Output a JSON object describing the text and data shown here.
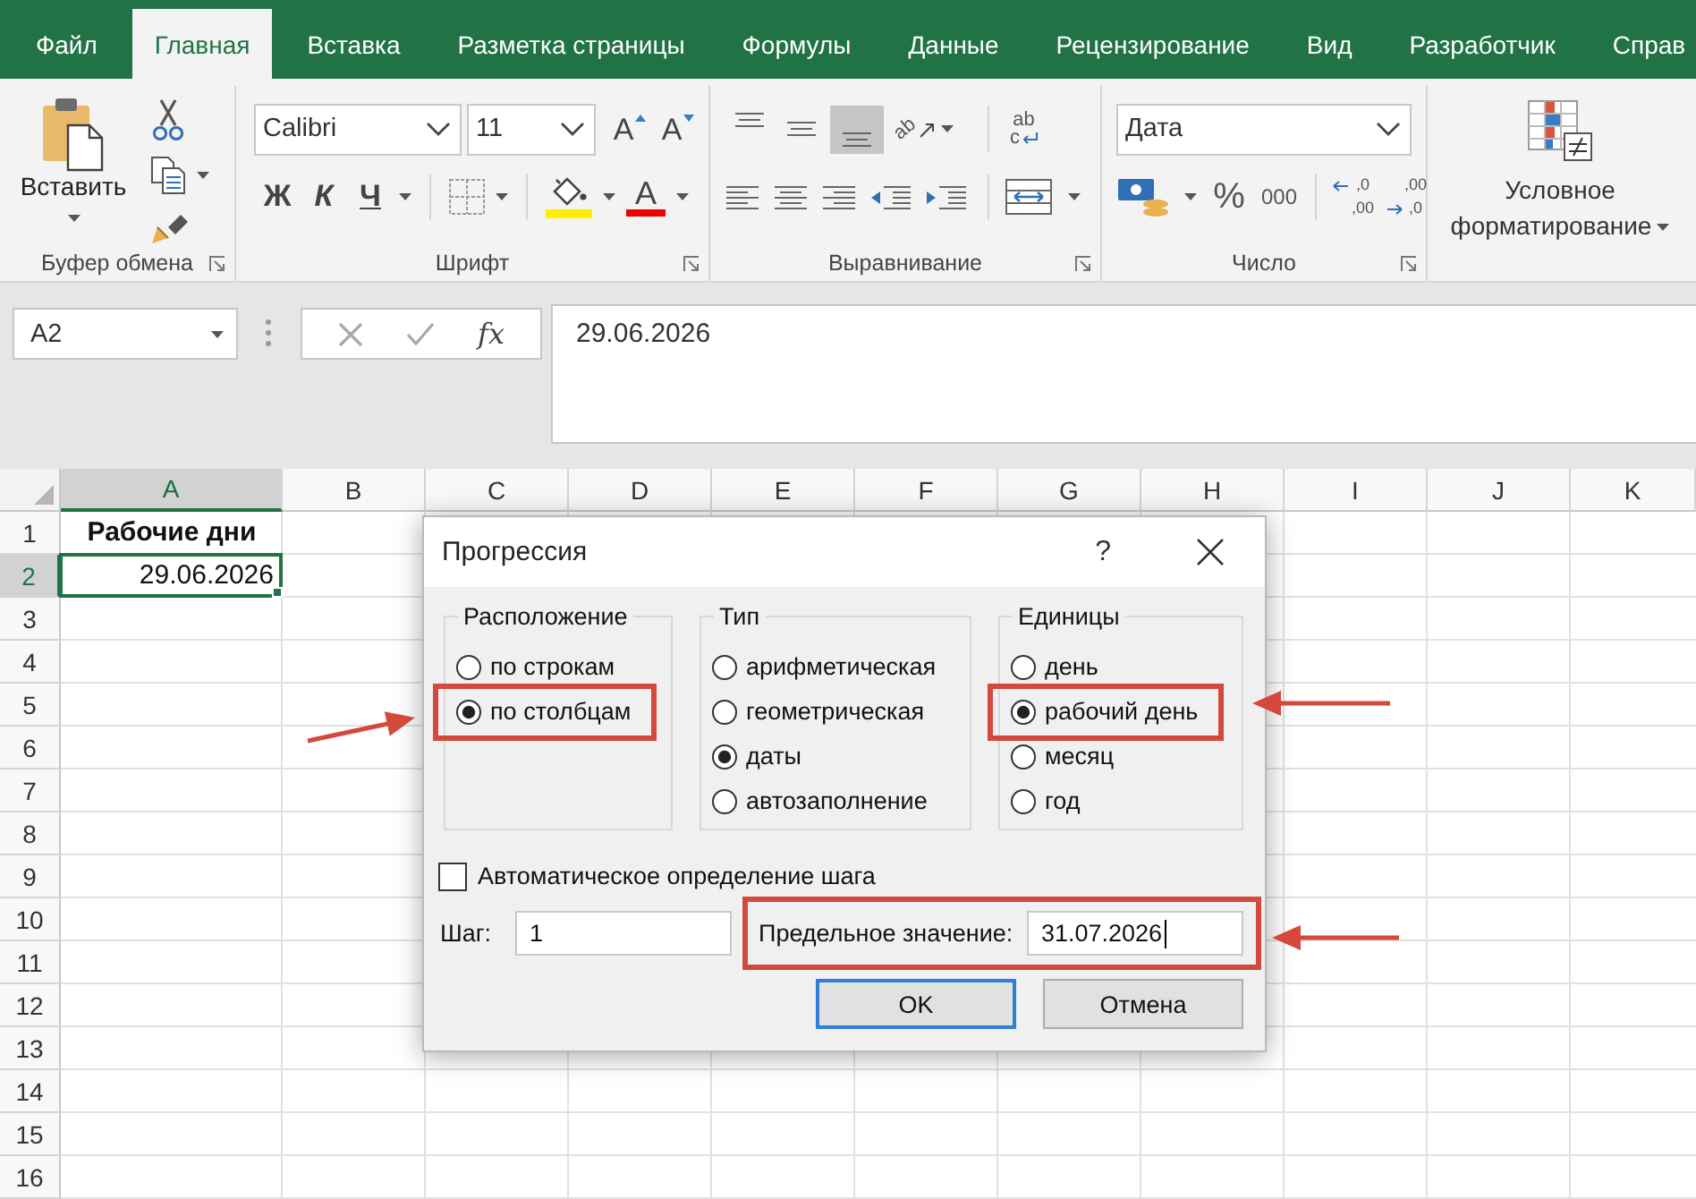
{
  "ribbon_tabs": [
    {
      "label": "Файл",
      "selected": false
    },
    {
      "label": "Главная",
      "selected": true
    },
    {
      "label": "Вставка",
      "selected": false
    },
    {
      "label": "Разметка страницы",
      "selected": false
    },
    {
      "label": "Формулы",
      "selected": false
    },
    {
      "label": "Данные",
      "selected": false
    },
    {
      "label": "Рецензирование",
      "selected": false
    },
    {
      "label": "Вид",
      "selected": false
    },
    {
      "label": "Разработчик",
      "selected": false
    },
    {
      "label": "Справ",
      "selected": false
    }
  ],
  "ribbon": {
    "clipboard": {
      "paste": "Вставить",
      "group_label": "Буфер обмена"
    },
    "font": {
      "font_name": "Calibri",
      "font_size": "11",
      "grow_font": "A",
      "shrink_font": "A",
      "bold": "Ж",
      "italic": "К",
      "underline": "Ч",
      "font_color": "A",
      "group_label": "Шрифт"
    },
    "alignment": {
      "vertical_align": [
        {
          "selected": false
        },
        {
          "selected": false
        },
        {
          "selected": true
        }
      ],
      "orientation": "ab",
      "wrap_text": [
        "ab",
        "c"
      ],
      "group_label": "Выравнивание"
    },
    "number": {
      "format": "Дата",
      "percent": "%",
      "thousands": "000",
      "increase_decimal": [
        ",0",
        ",00"
      ],
      "decrease_decimal": [
        ",00",
        ",0"
      ],
      "group_label": "Число"
    },
    "styles": {
      "conditional_formatting": "Условное форматирование"
    }
  },
  "formula_bar": {
    "name_box": "A2",
    "function_label": "fx",
    "formula": "29.06.2026"
  },
  "sheet": {
    "columns": [
      {
        "label": "A",
        "selected": true
      },
      {
        "label": "B",
        "selected": false
      },
      {
        "label": "C",
        "selected": false
      },
      {
        "label": "D",
        "selected": false
      },
      {
        "label": "E",
        "selected": false
      },
      {
        "label": "F",
        "selected": false
      },
      {
        "label": "G",
        "selected": false
      },
      {
        "label": "H",
        "selected": false
      },
      {
        "label": "I",
        "selected": false
      },
      {
        "label": "J",
        "selected": false
      },
      {
        "label": "K",
        "selected": false
      }
    ],
    "rows": [
      {
        "label": "1",
        "selected": false,
        "cells": [
          {
            "text": "Рабочие дни",
            "kind": "heading",
            "active": false
          }
        ]
      },
      {
        "label": "2",
        "selected": true,
        "cells": [
          {
            "text": "29.06.2026",
            "kind": "date",
            "active": true
          }
        ]
      },
      {
        "label": "3",
        "selected": false
      },
      {
        "label": "4",
        "selected": false
      },
      {
        "label": "5",
        "selected": false
      },
      {
        "label": "6",
        "selected": false
      },
      {
        "label": "7",
        "selected": false
      },
      {
        "label": "8",
        "selected": false
      },
      {
        "label": "9",
        "selected": false
      },
      {
        "label": "10",
        "selected": false
      },
      {
        "label": "11",
        "selected": false
      },
      {
        "label": "12",
        "selected": false
      },
      {
        "label": "13",
        "selected": false
      },
      {
        "label": "14",
        "selected": false
      },
      {
        "label": "15",
        "selected": false
      },
      {
        "label": "16",
        "selected": false
      }
    ]
  },
  "dialog": {
    "title": "Прогрессия",
    "help": "?",
    "groups": [
      {
        "title": "Расположение",
        "options": [
          {
            "label": "по строкам",
            "selected": false,
            "highlighted": false
          },
          {
            "label": "по столбцам",
            "selected": true,
            "highlighted": true
          }
        ]
      },
      {
        "title": "Тип",
        "options": [
          {
            "label": "арифметическая",
            "selected": false,
            "highlighted": false
          },
          {
            "label": "геометрическая",
            "selected": false,
            "highlighted": false
          },
          {
            "label": "даты",
            "selected": true,
            "highlighted": false
          },
          {
            "label": "автозаполнение",
            "selected": false,
            "highlighted": false
          }
        ]
      },
      {
        "title": "Единицы",
        "options": [
          {
            "label": "день",
            "selected": false,
            "highlighted": false
          },
          {
            "label": "рабочий день",
            "selected": true,
            "highlighted": true
          },
          {
            "label": "месяц",
            "selected": false,
            "highlighted": false
          },
          {
            "label": "год",
            "selected": false,
            "highlighted": false
          }
        ]
      }
    ],
    "auto_step": {
      "label": "Автоматическое определение шага",
      "checked": false
    },
    "step": {
      "label": "Шаг:",
      "value": "1"
    },
    "limit": {
      "label": "Предельное значение:",
      "value": "31.07.2026",
      "highlighted": true,
      "focused": true
    },
    "buttons": [
      {
        "label": "OK",
        "default": true
      },
      {
        "label": "Отмена",
        "default": false
      }
    ]
  }
}
